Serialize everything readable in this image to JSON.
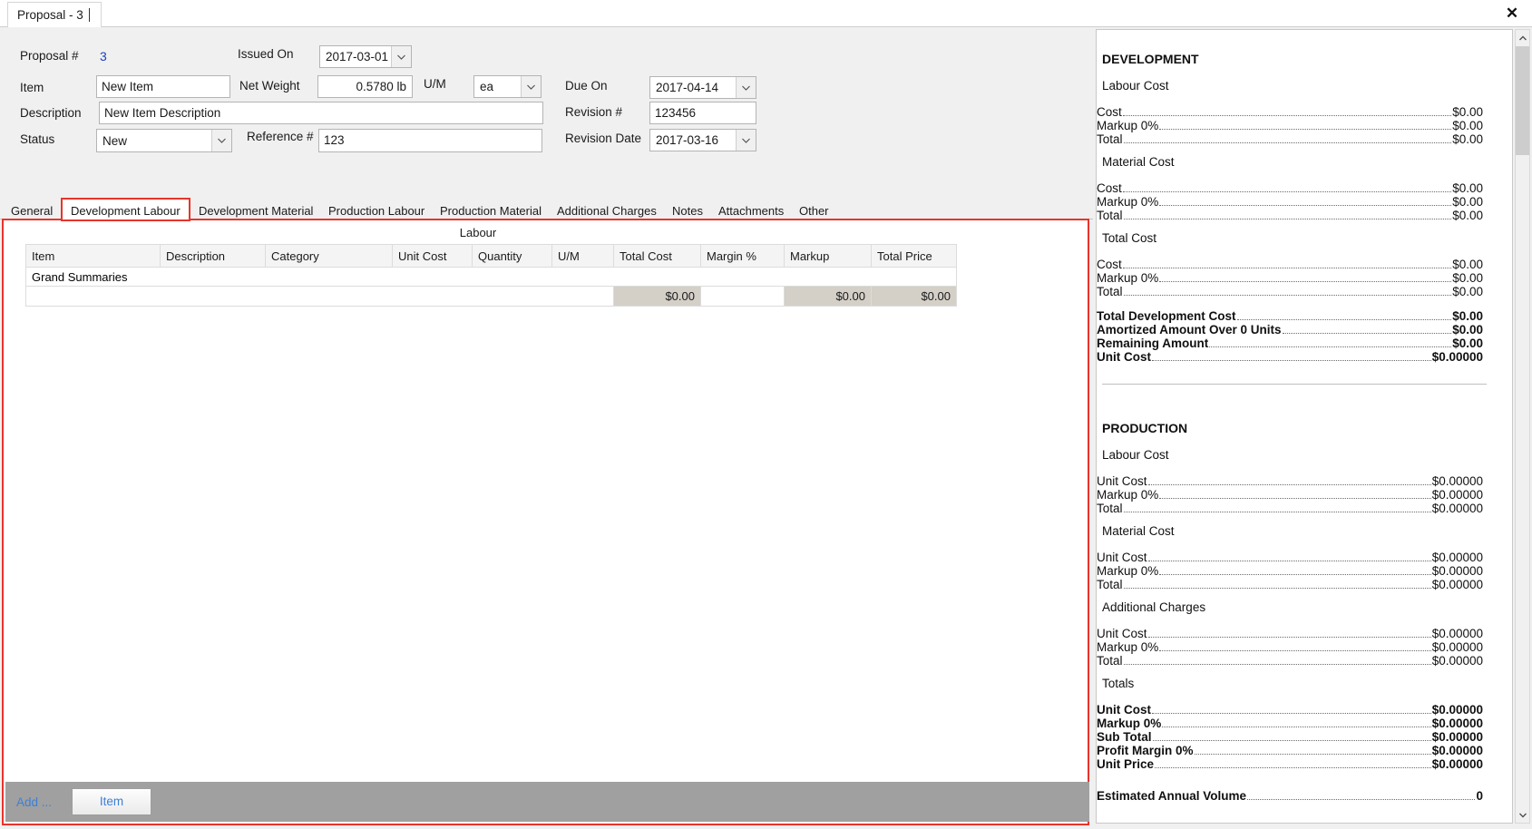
{
  "window": {
    "document_tab": "Proposal - 3",
    "close_icon": "close-icon"
  },
  "header_form": {
    "proposal_number_label": "Proposal #",
    "proposal_number_value": "3",
    "item_label": "Item",
    "item_value": "New Item",
    "description_label": "Description",
    "description_value": "New Item Description",
    "status_label": "Status",
    "status_value": "New",
    "issued_on_label": "Issued On",
    "issued_on_value": "2017-03-01",
    "net_weight_label": "Net Weight",
    "net_weight_value": "0.5780 lb",
    "um_label": "U/M",
    "um_value": "ea",
    "reference_label": "Reference #",
    "reference_value": "123",
    "due_on_label": "Due On",
    "due_on_value": "2017-04-14",
    "revision_number_label": "Revision #",
    "revision_number_value": "123456",
    "revision_date_label": "Revision Date",
    "revision_date_value": "2017-03-16"
  },
  "tabs": [
    {
      "label": "General",
      "active": false
    },
    {
      "label": "Development Labour",
      "active": true
    },
    {
      "label": "Development Material",
      "active": false
    },
    {
      "label": "Production Labour",
      "active": false
    },
    {
      "label": "Production Material",
      "active": false
    },
    {
      "label": "Additional Charges",
      "active": false
    },
    {
      "label": "Notes",
      "active": false
    },
    {
      "label": "Attachments",
      "active": false
    },
    {
      "label": "Other",
      "active": false
    }
  ],
  "grid": {
    "caption": "Labour",
    "columns": [
      "Item",
      "Description",
      "Category",
      "Unit Cost",
      "Quantity",
      "U/M",
      "Total Cost",
      "Margin %",
      "Markup",
      "Total Price"
    ],
    "group_row_label": "Grand Summaries",
    "summary_row": {
      "item": "",
      "description": "",
      "category": "",
      "unit_cost": "",
      "quantity": "",
      "um": "",
      "total_cost": "$0.00",
      "margin_pct": "",
      "markup": "$0.00",
      "total_price": "$0.00"
    }
  },
  "bottom_toolbar": {
    "add_label": "Add ...",
    "item_button": "Item"
  },
  "summary_panel": {
    "development": {
      "title": "DEVELOPMENT",
      "groups": [
        {
          "heading": "Labour Cost",
          "rows": [
            {
              "label": "Cost",
              "value": "$0.00"
            },
            {
              "label": "Markup 0%",
              "value": "$0.00"
            },
            {
              "label": "Total",
              "value": "$0.00"
            }
          ]
        },
        {
          "heading": "Material Cost",
          "rows": [
            {
              "label": "Cost",
              "value": "$0.00"
            },
            {
              "label": "Markup 0%",
              "value": "$0.00"
            },
            {
              "label": "Total",
              "value": "$0.00"
            }
          ]
        },
        {
          "heading": "Total Cost",
          "rows": [
            {
              "label": "Cost",
              "value": "$0.00"
            },
            {
              "label": "Markup 0%",
              "value": "$0.00"
            },
            {
              "label": "Total",
              "value": "$0.00"
            }
          ]
        }
      ],
      "totals": [
        {
          "label": "Total Development Cost",
          "value": "$0.00"
        },
        {
          "label": "Amortized Amount Over 0 Units",
          "value": "$0.00"
        },
        {
          "label": "Remaining Amount",
          "value": "$0.00"
        },
        {
          "label": "Unit Cost",
          "value": "$0.00000"
        }
      ]
    },
    "production": {
      "title": "PRODUCTION",
      "groups": [
        {
          "heading": "Labour Cost",
          "rows": [
            {
              "label": "Unit Cost",
              "value": "$0.00000"
            },
            {
              "label": "Markup 0%",
              "value": "$0.00000"
            },
            {
              "label": "Total",
              "value": "$0.00000"
            }
          ]
        },
        {
          "heading": "Material Cost",
          "rows": [
            {
              "label": "Unit Cost",
              "value": "$0.00000"
            },
            {
              "label": "Markup 0%",
              "value": "$0.00000"
            },
            {
              "label": "Total",
              "value": "$0.00000"
            }
          ]
        },
        {
          "heading": "Additional Charges",
          "rows": [
            {
              "label": "Unit Cost",
              "value": "$0.00000"
            },
            {
              "label": "Markup 0%",
              "value": "$0.00000"
            },
            {
              "label": "Total",
              "value": "$0.00000"
            }
          ]
        },
        {
          "heading": "Totals",
          "bold": true,
          "rows": [
            {
              "label": "Unit Cost",
              "value": "$0.00000"
            },
            {
              "label": "Markup 0%",
              "value": "$0.00000"
            },
            {
              "label": "Sub Total",
              "value": "$0.00000"
            },
            {
              "label": "Profit Margin 0%",
              "value": "$0.00000"
            },
            {
              "label": "Unit Price",
              "value": "$0.00000"
            }
          ]
        }
      ],
      "footer": [
        {
          "label": "Estimated Annual Volume",
          "value": "0"
        }
      ]
    }
  },
  "colors": {
    "accent_red": "#e8342b",
    "link_blue": "#3d7fd6",
    "value_blue": "#1f3fbf",
    "toolbar_grey": "#a0a0a0",
    "summary_grey": "#d4d0c8"
  }
}
